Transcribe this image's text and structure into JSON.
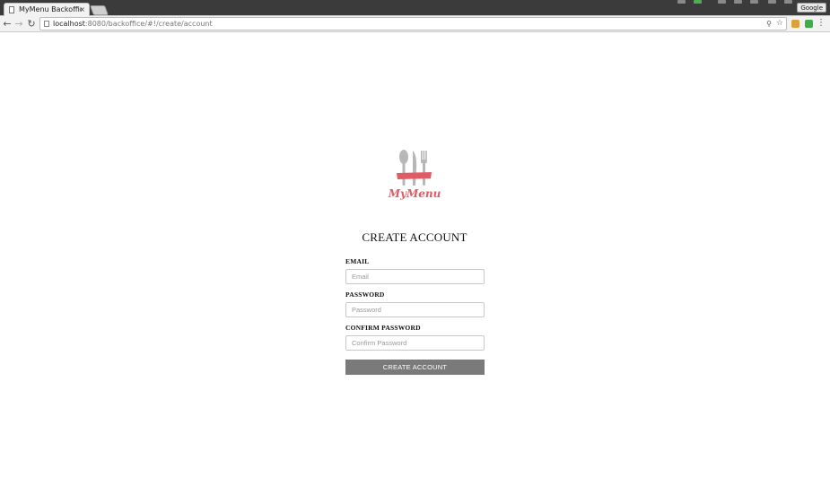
{
  "browser": {
    "tab_title": "MyMenu Backoffice",
    "tab_close": "×",
    "profile_label": "Google",
    "url_host": "localhost",
    "url_path": ":8080/backoffice/#!/create/account",
    "nav": {
      "back": "←",
      "forward": "→",
      "reload": "↻"
    },
    "menu_glyph": "⋮",
    "star_glyph": "☆",
    "key_glyph": "⚲"
  },
  "logo": {
    "text": "MyMenu",
    "accent_color": "#e05b66",
    "utensil_color": "#b7b7b7"
  },
  "form": {
    "title": "CREATE ACCOUNT",
    "email_label": "EMAIL",
    "email_placeholder": "Email",
    "email_value": "",
    "password_label": "PASSWORD",
    "password_placeholder": "Password",
    "password_value": "",
    "confirm_label": "CONFIRM PASSWORD",
    "confirm_placeholder": "Confirm Password",
    "confirm_value": "",
    "submit_label": "CREATE ACCOUNT",
    "button_color": "#7a7a7a"
  }
}
